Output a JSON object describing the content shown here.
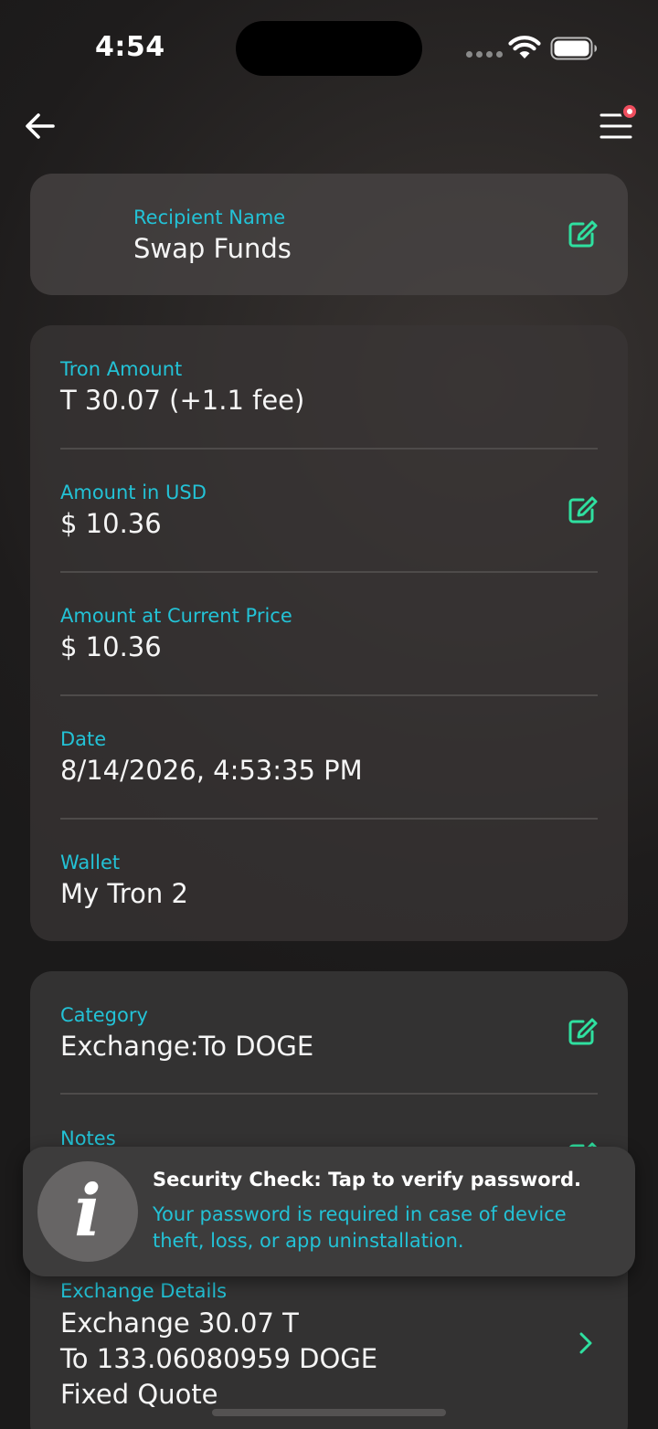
{
  "status_bar": {
    "time": "4:54"
  },
  "recipient": {
    "label": "Recipient Name",
    "value": "Swap Funds"
  },
  "details": {
    "tron_amount": {
      "label": "Tron Amount",
      "value": "T 30.07 (+1.1 fee)"
    },
    "amount_usd": {
      "label": "Amount in USD",
      "value": "$ 10.36"
    },
    "amount_current": {
      "label": "Amount at Current Price",
      "value": "$ 10.36"
    },
    "date": {
      "label": "Date",
      "value": "8/14/2026, 4:53:35 PM"
    },
    "wallet": {
      "label": "Wallet",
      "value": "My Tron 2"
    }
  },
  "category_card": {
    "category": {
      "label": "Category",
      "value": "Exchange:To DOGE"
    },
    "notes": {
      "label": "Notes"
    },
    "exchange": {
      "label": "Exchange Details",
      "line1": "Exchange 30.07 T",
      "line2": "To 133.06080959 DOGE",
      "line3": "Fixed Quote"
    }
  },
  "toast": {
    "title": "Security Check: Tap to verify password.",
    "body": "Your password is required in case of device theft, loss, or app uninstallation.",
    "icon_letter": "i"
  },
  "colors": {
    "accent_teal": "#23c2d6",
    "edit_green": "#2fe0a0",
    "badge_red": "#ef4e5e"
  },
  "icons": {
    "back": "arrow-left-icon",
    "menu": "hamburger-menu-icon",
    "edit": "edit-pencil-icon",
    "chevron": "chevron-right-icon",
    "info": "info-icon"
  }
}
